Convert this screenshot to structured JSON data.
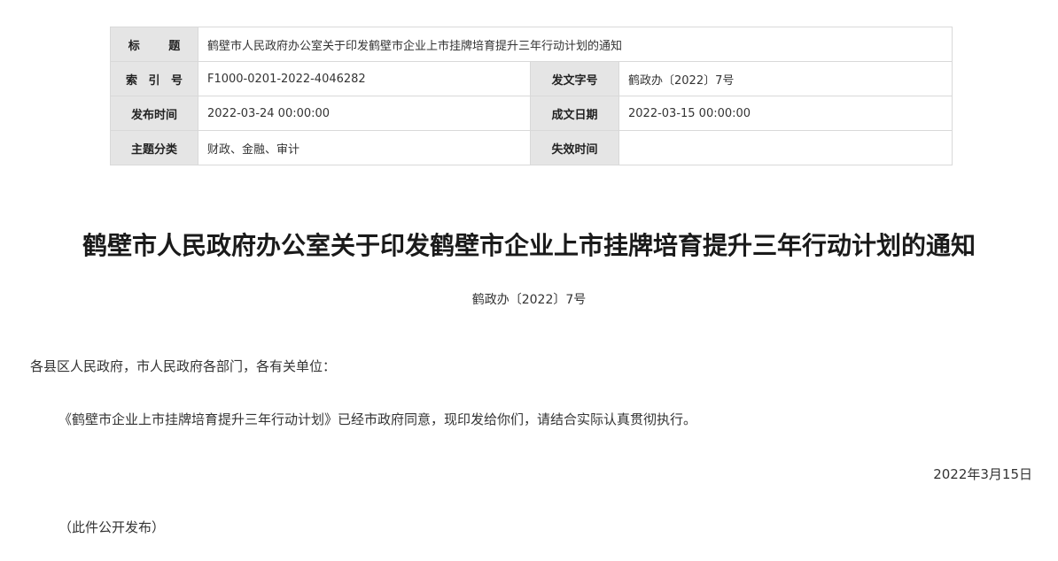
{
  "meta": {
    "title_label": "标  题",
    "title_value": "鹤壁市人民政府办公室关于印发鹤壁市企业上市挂牌培育提升三年行动计划的通知",
    "index_label": "索 引 号",
    "index_value": "F1000-0201-2022-4046282",
    "doc_no_label": "发文字号",
    "doc_no_value": "鹤政办〔2022〕7号",
    "publish_time_label": "发布时间",
    "publish_time_value": "2022-03-24 00:00:00",
    "written_date_label": "成文日期",
    "written_date_value": "2022-03-15 00:00:00",
    "topic_label": "主题分类",
    "topic_value": "财政、金融、审计",
    "expire_label": "失效时间",
    "expire_value": ""
  },
  "document": {
    "title": "鹤壁市人民政府办公室关于印发鹤壁市企业上市挂牌培育提升三年行动计划的通知",
    "doc_number": "鹤政办〔2022〕7号",
    "salutation": "各县区人民政府，市人民政府各部门，各有关单位：",
    "paragraph": "《鹤壁市企业上市挂牌培育提升三年行动计划》已经市政府同意，现印发给你们，请结合实际认真贯彻执行。",
    "date": "2022年3月15日",
    "publish_note": "（此件公开发布）"
  }
}
